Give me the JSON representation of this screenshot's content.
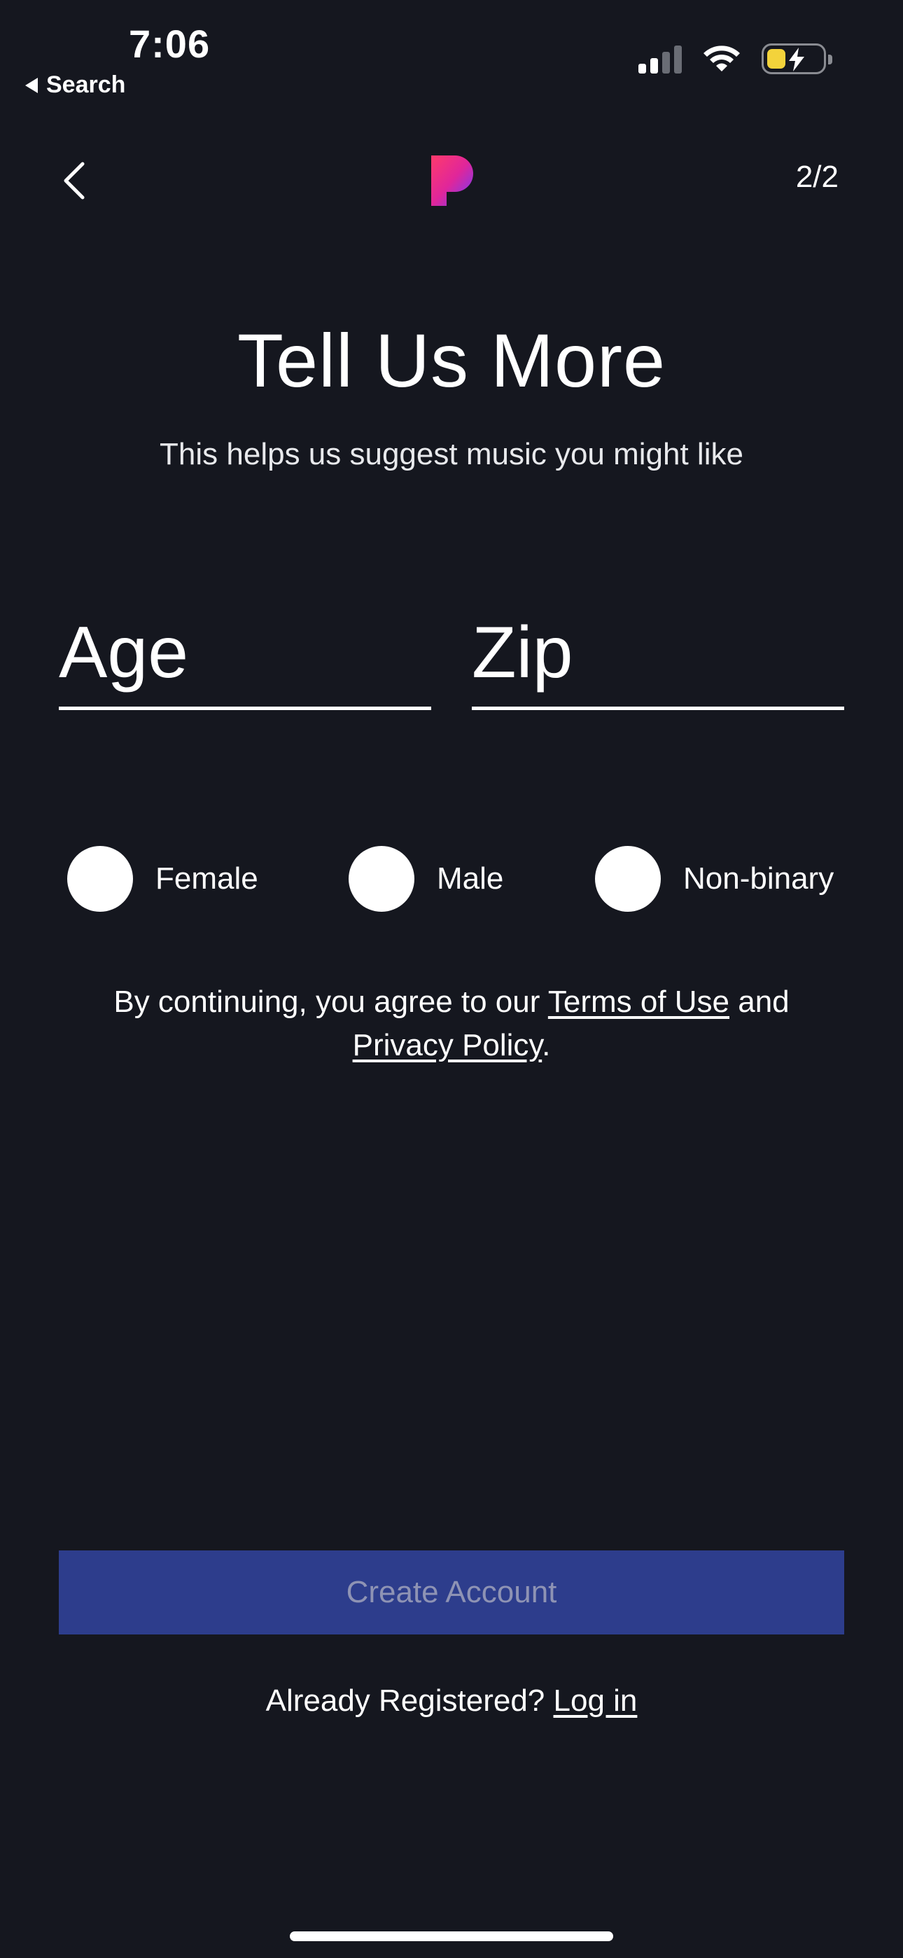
{
  "status_bar": {
    "time": "7:06",
    "back_label": "Search",
    "icons": [
      "signal-icon",
      "wifi-icon",
      "battery-charging-icon"
    ]
  },
  "header": {
    "back_icon": "chevron-left-icon",
    "logo": "pandora-logo",
    "step": "2/2"
  },
  "main": {
    "title": "Tell Us More",
    "subtitle": "This helps us suggest music you might like",
    "age_placeholder": "Age",
    "zip_placeholder": "Zip",
    "gender_options": [
      "Female",
      "Male",
      "Non-binary"
    ],
    "terms_prefix": "By continuing, you agree to our ",
    "terms_link": "Terms of Use",
    "terms_middle": " and",
    "privacy_link": "Privacy Policy",
    "terms_suffix": "."
  },
  "footer": {
    "create_account_label": "Create Account",
    "already_registered": "Already Registered? ",
    "login_link": "Log in"
  },
  "colors": {
    "background": "#15171f",
    "button": "#2d3d8c",
    "button_text": "#8e93b4",
    "battery_fill": "#f3d33b"
  }
}
